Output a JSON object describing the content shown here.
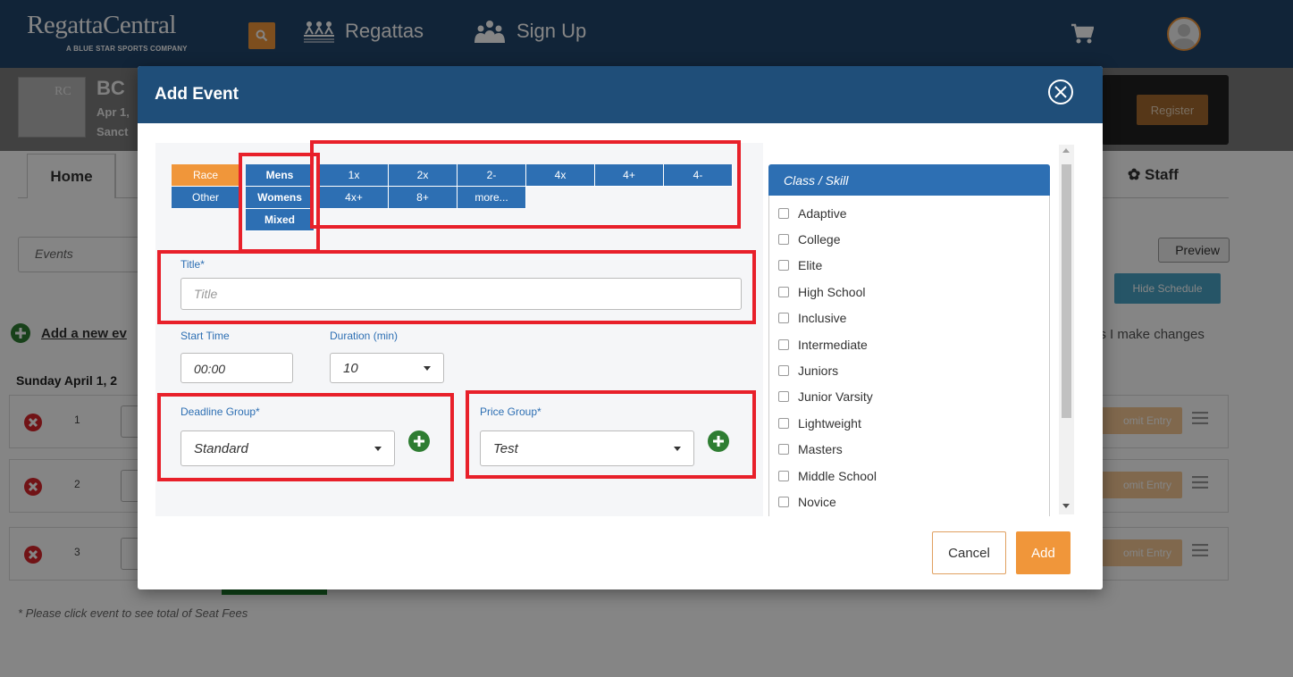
{
  "nav": {
    "logo": "RegattaCentral",
    "logo_sub": "A BLUE STAR SPORTS COMPANY",
    "regattas": "Regattas",
    "signup": "Sign Up"
  },
  "regatta": {
    "name": "BC",
    "date": "Apr 1,",
    "place": "Sanct",
    "thumb": "RC",
    "register": "Register"
  },
  "tabs": {
    "home": "Home",
    "staff": "Staff"
  },
  "page": {
    "events_placeholder": "Events",
    "preview": "Preview",
    "hide_schedule": "Hide Schedule",
    "add_new": "Add a new ev",
    "changes": "as I make changes",
    "day": "Sunday April 1, 2",
    "rows": [
      {
        "num": "1",
        "submit": "omit Entry"
      },
      {
        "num": "2",
        "submit": "omit Entry"
      },
      {
        "num": "3",
        "submit": "omit Entry"
      }
    ],
    "footnote": "* Please click event to see total of Seat Fees"
  },
  "modal": {
    "title": "Add Event",
    "type": {
      "race": "Race",
      "other": "Other"
    },
    "gender": {
      "mens": "Mens",
      "womens": "Womens",
      "mixed": "Mixed"
    },
    "boats_row1": [
      "1x",
      "2x",
      "2-",
      "4x",
      "4+",
      "4-"
    ],
    "boats_row2": [
      "4x+",
      "8+",
      "more..."
    ],
    "title_label": "Title*",
    "title_placeholder": "Title",
    "start_time_label": "Start Time",
    "start_time_value": "00:00",
    "duration_label": "Duration (min)",
    "duration_value": "10",
    "deadline_label": "Deadline Group*",
    "deadline_value": "Standard",
    "price_label": "Price Group*",
    "price_value": "Test",
    "class_header": "Class / Skill",
    "classes": [
      "Adaptive",
      "College",
      "Elite",
      "High School",
      "Inclusive",
      "Intermediate",
      "Juniors",
      "Junior Varsity",
      "Lightweight",
      "Masters",
      "Middle School",
      "Novice"
    ],
    "cancel": "Cancel",
    "add": "Add"
  },
  "colors": {
    "nav": "#22456b",
    "modal_header": "#1f4e79",
    "accent": "#f0963a",
    "button_blue": "#2d6fb3",
    "annotation": "#e8202a"
  }
}
